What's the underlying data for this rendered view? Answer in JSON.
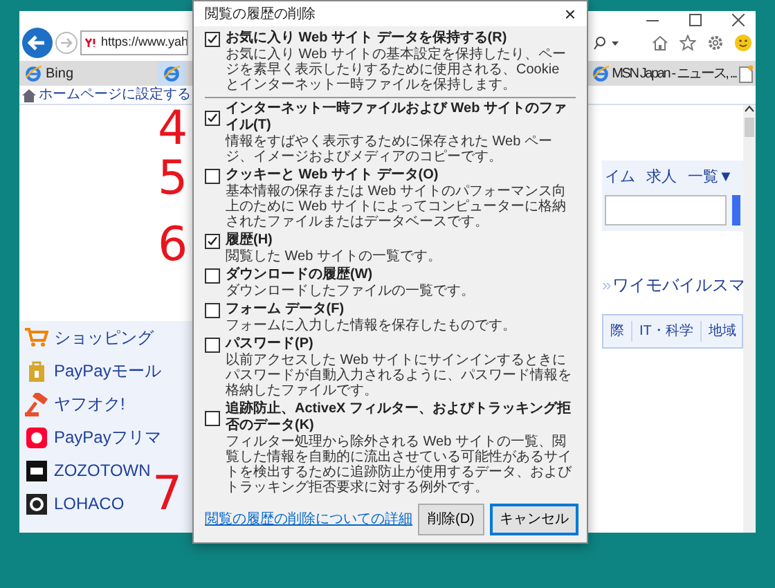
{
  "browser": {
    "address": "https://www.yah",
    "tabs": [
      {
        "label": "Bing",
        "selected": false
      },
      {
        "selected": true
      },
      {
        "label": "MSN Japan - ニュース, ...",
        "selected": false
      }
    ],
    "favorites_bar": {
      "link": "ホームページに設定する"
    },
    "page": {
      "sidebar": [
        "ショッピング",
        "PayPayモール",
        "ヤフオク!",
        "PayPayフリマ",
        "ZOZOTOWN",
        "LOHACO"
      ],
      "nav_links": [
        "イム",
        "求人",
        "一覧▼"
      ],
      "promo_marker": "»",
      "promo_link": "ワイモバイルスマ",
      "categories": [
        "際",
        "IT・科学",
        "地域"
      ]
    }
  },
  "dialog": {
    "title": "閲覧の履歴の削除",
    "close": "×",
    "keep_option": {
      "label": "お気に入り Web サイト データを保持する(R)",
      "description": "お気に入り Web サイトの基本設定を保持したり、ページを素早く表示したりするために使用される、Cookie とインターネット一時ファイルを保持します。",
      "checked": true
    },
    "options": [
      {
        "label": "インターネット一時ファイルおよび Web サイトのファイル(T)",
        "description": "情報をすばやく表示するために保存された Web ページ、イメージおよびメディアのコピーです。",
        "checked": true
      },
      {
        "label": "クッキーと Web サイト データ(O)",
        "description": "基本情報の保存または Web サイトのパフォーマンス向上のために Web サイトによってコンピューターに格納されたファイルまたはデータベースです。",
        "checked": false
      },
      {
        "label": "履歴(H)",
        "description": "閲覧した Web サイトの一覧です。",
        "checked": true
      },
      {
        "label": "ダウンロードの履歴(W)",
        "description": "ダウンロードしたファイルの一覧です。",
        "checked": false
      },
      {
        "label": "フォーム データ(F)",
        "description": "フォームに入力した情報を保存したものです。",
        "checked": false
      },
      {
        "label": "パスワード(P)",
        "description": "以前アクセスした Web サイトにサインインするときにパスワードが自動入力されるように、パスワード情報を格納したファイルです。",
        "checked": false
      },
      {
        "label": "追跡防止、ActiveX フィルター、およびトラッキング拒否のデータ(K)",
        "description": "フィルター処理から除外される Web サイトの一覧、閲覧した情報を自動的に流出させている可能性があるサイトを検出するために追跡防止が使用するデータ、およびトラッキング拒否要求に対する例外です。",
        "checked": false
      }
    ],
    "link": "閲覧の履歴の削除についての詳細",
    "buttons": [
      {
        "label": "削除(D)",
        "default": false
      },
      {
        "label": "キャンセル",
        "default": true
      }
    ]
  },
  "annotations": [
    "4",
    "5",
    "6",
    "7"
  ]
}
